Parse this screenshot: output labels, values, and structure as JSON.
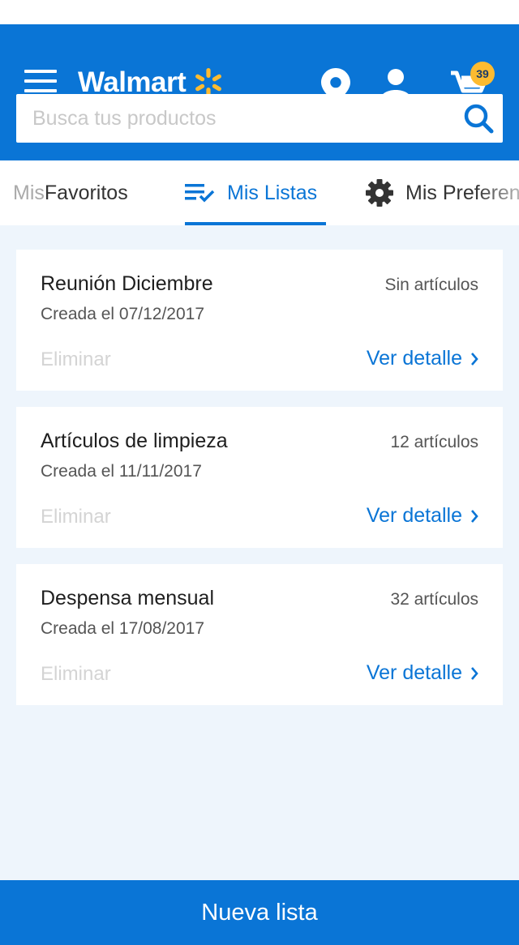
{
  "header": {
    "logo_text": "Walmart",
    "cart_count": "39",
    "colors": {
      "brand_blue": "#0a75d6",
      "spark_yellow": "#fdbb30"
    }
  },
  "search": {
    "placeholder": "Busca tus productos",
    "value": ""
  },
  "tabs": [
    {
      "label_prefix": "Mis ",
      "label": "Favoritos",
      "icon": "heart-icon"
    },
    {
      "label": "Mis Listas",
      "icon": "checklist-icon",
      "active": true
    },
    {
      "label": "Mis Preferen",
      "icon": "gear-icon"
    }
  ],
  "lists": [
    {
      "name": "Reunión Diciembre",
      "count": "Sin artículos",
      "date": "Creada el 07/12/2017",
      "delete_label": "Eliminar",
      "detail_label": "Ver detalle"
    },
    {
      "name": "Artículos de limpieza",
      "count": "12 artículos",
      "date": "Creada el 11/11/2017",
      "delete_label": "Eliminar",
      "detail_label": "Ver detalle"
    },
    {
      "name": "Despensa mensual",
      "count": "32 artículos",
      "date": "Creada el 17/08/2017",
      "delete_label": "Eliminar",
      "detail_label": "Ver detalle"
    }
  ],
  "footer": {
    "new_list_label": "Nueva lista"
  }
}
